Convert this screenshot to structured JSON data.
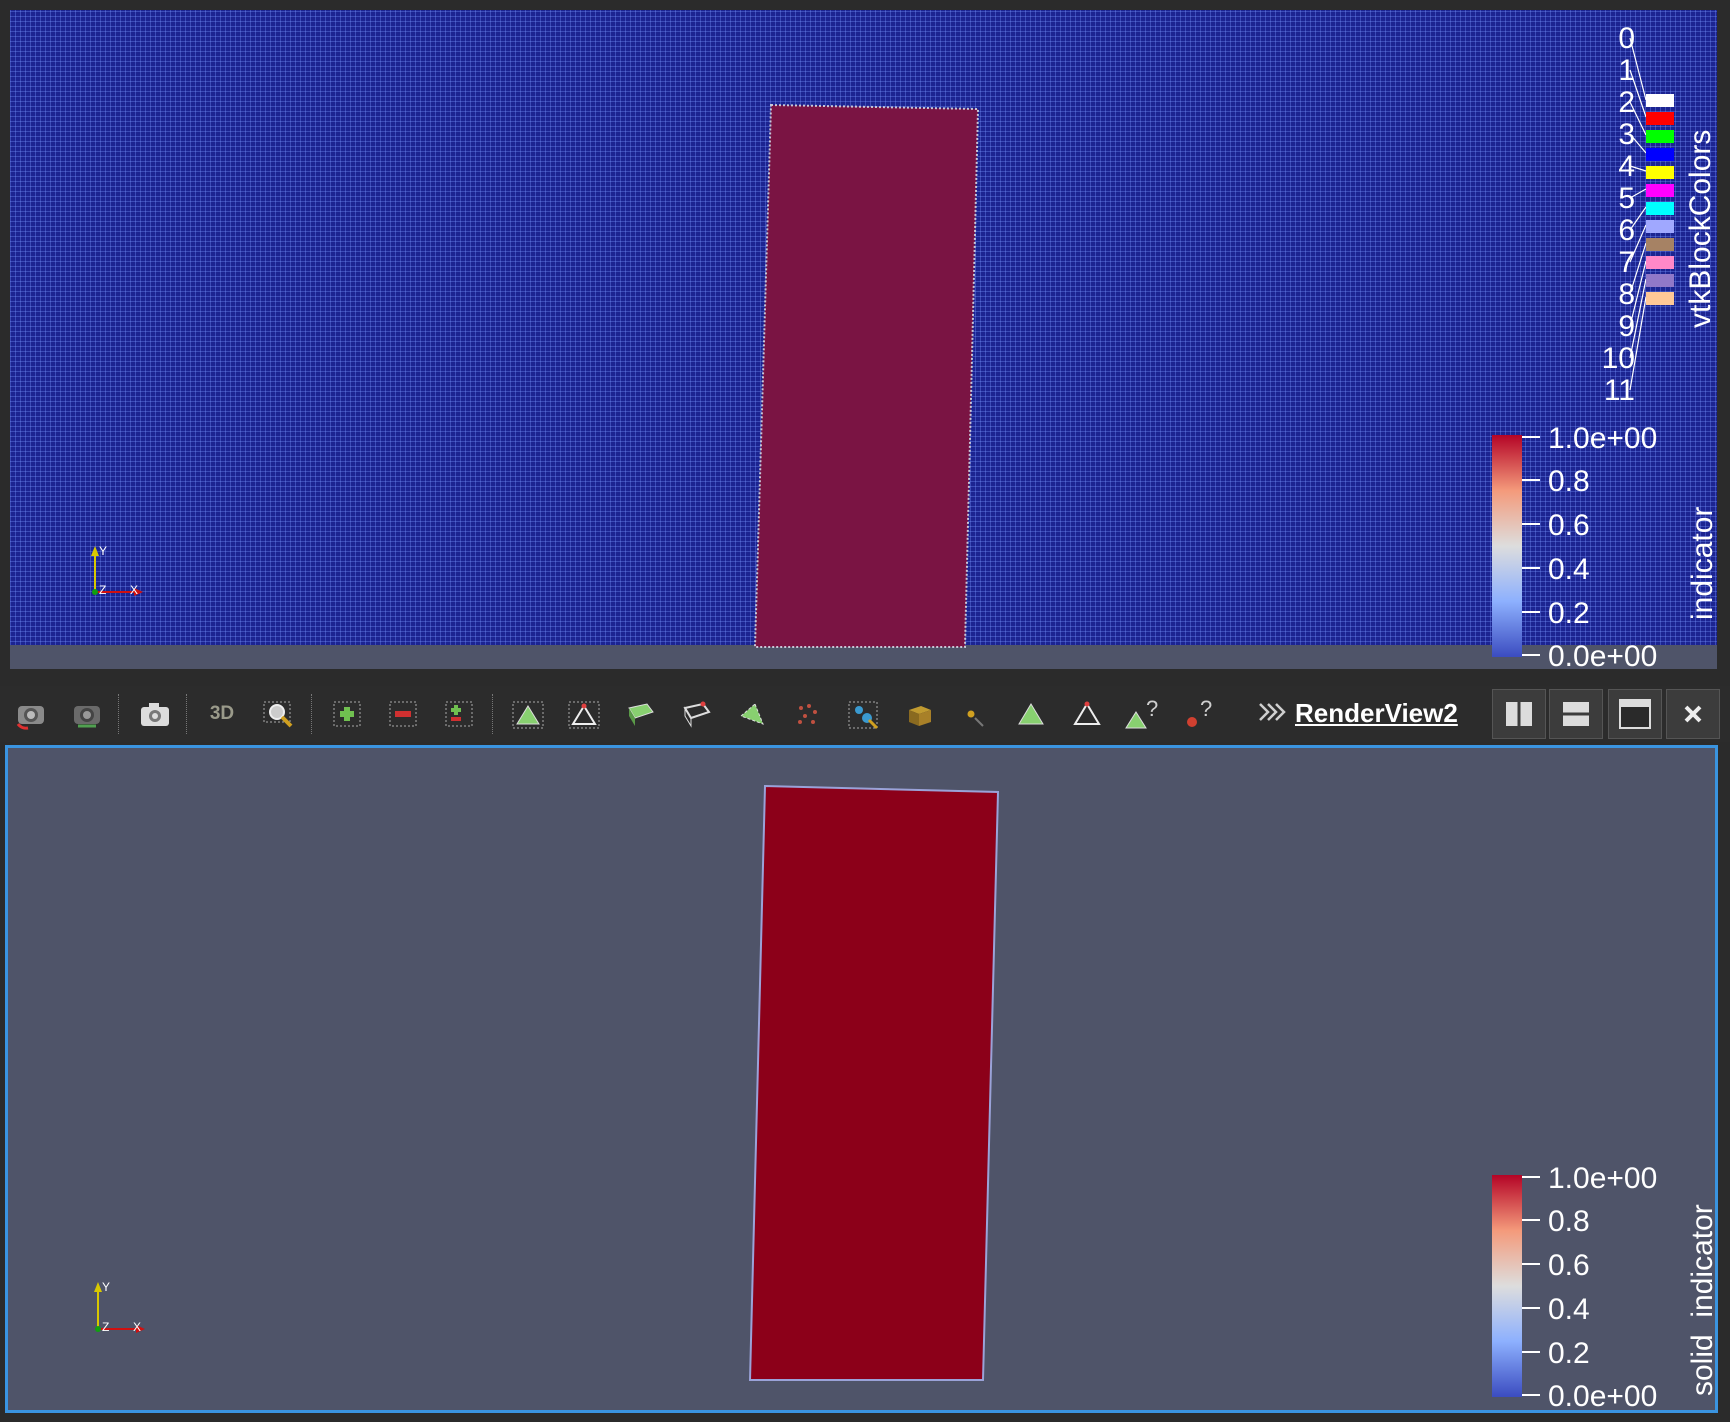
{
  "toolbar": {
    "view_title": "RenderView2",
    "label_3d": "3D",
    "more": "»",
    "icons": [
      "reset-camera-icon",
      "zoom-closest-icon",
      "capture-screenshot-icon",
      "toggle-3d-icon",
      "zoom-to-box-icon",
      "add-icon",
      "remove-icon",
      "interactive-select-icon",
      "select-cells-on-icon",
      "select-points-on-icon",
      "select-cells-frustum-icon",
      "select-points-frustum-icon",
      "select-polygon-cells-icon",
      "select-polygon-points-icon",
      "select-block-icon",
      "interactive-select-cells-icon",
      "interactive-select-points-icon",
      "hover-cells-icon",
      "hover-points-icon"
    ]
  },
  "view1": {
    "block_legend": {
      "title": "vtkBlockColors",
      "labels": [
        "0",
        "1",
        "2",
        "3",
        "4",
        "5",
        "6",
        "7",
        "8",
        "9",
        "10",
        "11"
      ],
      "swatches": [
        "#ffffff",
        "#ff0000",
        "#00ff00",
        "#0000ff",
        "#ffff00",
        "#ff00ff",
        "#00ffff",
        "#a0a8ff",
        "#a68264",
        "#ff88c8",
        "#9078c8",
        "#ffc896"
      ]
    },
    "scalar_bar": {
      "title": "indicator",
      "ticks": [
        "1.0e+00",
        "0.8",
        "0.6",
        "0.4",
        "0.2",
        "0.0e+00"
      ]
    },
    "axes": {
      "y": "Y",
      "z": "Z",
      "x": "X"
    }
  },
  "view2": {
    "scalar_bar": {
      "title": "solid_indicator",
      "ticks": [
        "1.0e+00",
        "0.8",
        "0.6",
        "0.4",
        "0.2",
        "0.0e+00"
      ]
    },
    "axes": {
      "y": "Y",
      "z": "Z",
      "x": "X"
    }
  },
  "colors": {
    "mesh_blue": "#1c2491",
    "solid_red": "#8c0019",
    "background": "#4f5469",
    "active_border": "#3a94e0"
  }
}
